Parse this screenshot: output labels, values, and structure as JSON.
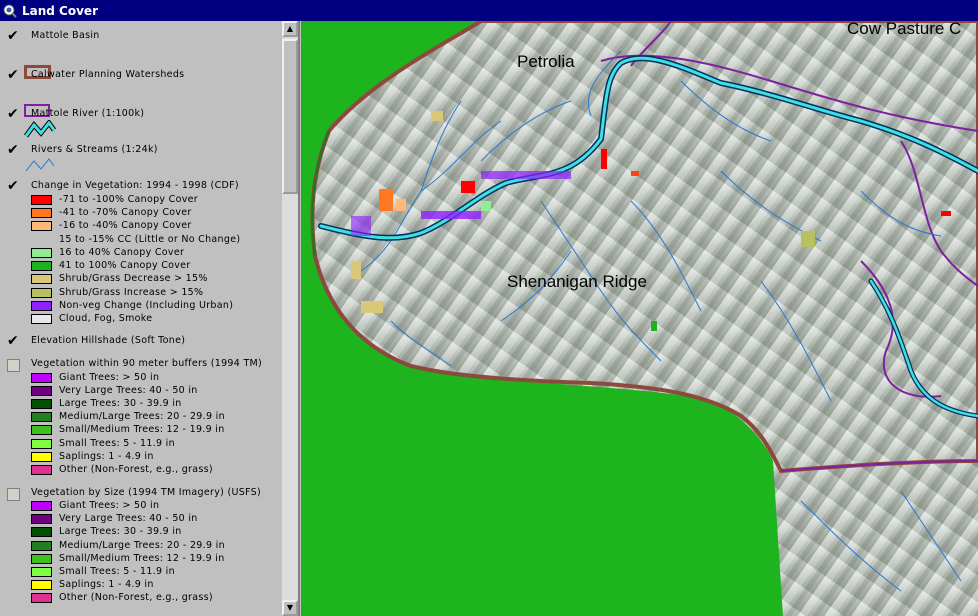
{
  "window": {
    "title": "Land Cover"
  },
  "legend": {
    "layers": [
      {
        "name": "Mattole Basin",
        "checked": true
      },
      {
        "name": "Calwater Planning Watersheds",
        "checked": true
      },
      {
        "name": "Mattole River (1:100k)",
        "checked": true
      },
      {
        "name": "Rivers & Streams (1:24k)",
        "checked": true
      },
      {
        "name": "Change in Vegetation: 1994 - 1998 (CDF)",
        "checked": true,
        "classes": [
          {
            "label": "-71 to -100% Canopy Cover",
            "color": "#ff0000"
          },
          {
            "label": "-41 to -70% Canopy Cover",
            "color": "#ff7820"
          },
          {
            "label": "-16 to -40% Canopy Cover",
            "color": "#ffb878"
          },
          {
            "label": "15 to -15% CC (Little or No Change)",
            "color": ""
          },
          {
            "label": "16 to 40% Canopy Cover",
            "color": "#90ee90"
          },
          {
            "label": "41 to 100% Canopy Cover",
            "color": "#20b020"
          },
          {
            "label": "Shrub/Grass Decrease > 15%",
            "color": "#d8c878"
          },
          {
            "label": "Shrub/Grass Increase > 15%",
            "color": "#b8c060"
          },
          {
            "label": "Non-veg Change (Including Urban)",
            "color": "#9020ff"
          },
          {
            "label": "Cloud, Fog, Smoke",
            "color": "#e8e8e8"
          }
        ]
      },
      {
        "name": "Elevation Hillshade (Soft Tone)",
        "checked": true
      },
      {
        "name": "Vegetation within 90 meter buffers (1994 TM)",
        "checked": false,
        "classes": [
          {
            "label": "Giant Trees: > 50 in",
            "color": "#c000ff"
          },
          {
            "label": "Very Large Trees: 40 - 50 in",
            "color": "#700080"
          },
          {
            "label": "Large Trees: 30 - 39.9 in",
            "color": "#005000"
          },
          {
            "label": "Medium/Large Trees: 20 - 29.9 in",
            "color": "#208020"
          },
          {
            "label": "Small/Medium Trees: 12 - 19.9 in",
            "color": "#40c020"
          },
          {
            "label": "Small Trees: 5 - 11.9 in",
            "color": "#80ff40"
          },
          {
            "label": "Saplings: 1 - 4.9 in",
            "color": "#ffff00"
          },
          {
            "label": "Other (Non-Forest, e.g., grass)",
            "color": "#e03090"
          }
        ]
      },
      {
        "name": "Vegetation by Size (1994 TM Imagery) (USFS)",
        "checked": false,
        "classes": [
          {
            "label": "Giant Trees: > 50 in",
            "color": "#c000ff"
          },
          {
            "label": "Very Large Trees: 40 - 50 in",
            "color": "#700080"
          },
          {
            "label": "Large Trees: 30 - 39.9 in",
            "color": "#005000"
          },
          {
            "label": "Medium/Large Trees: 20 - 29.9 in",
            "color": "#208020"
          },
          {
            "label": "Small/Medium Trees: 12 - 19.9 in",
            "color": "#40c020"
          },
          {
            "label": "Small Trees: 5 - 11.9 in",
            "color": "#80ff40"
          },
          {
            "label": "Saplings: 1 - 4.9 in",
            "color": "#ffff00"
          },
          {
            "label": "Other (Non-Forest, e.g., grass)",
            "color": "#e03090"
          }
        ]
      }
    ]
  },
  "map": {
    "labels": {
      "petrolia": "Petrolia",
      "shenanigan": "Shenanigan Ridge",
      "cow_pasture": "Cow Pasture C"
    },
    "colors": {
      "ocean": "#b4d2f0",
      "forest": "#1eb41e",
      "basin_outline": "#8b4a3c",
      "watershed": "#8020a0",
      "river": "#40e0e0",
      "stream": "#2878d0"
    }
  }
}
